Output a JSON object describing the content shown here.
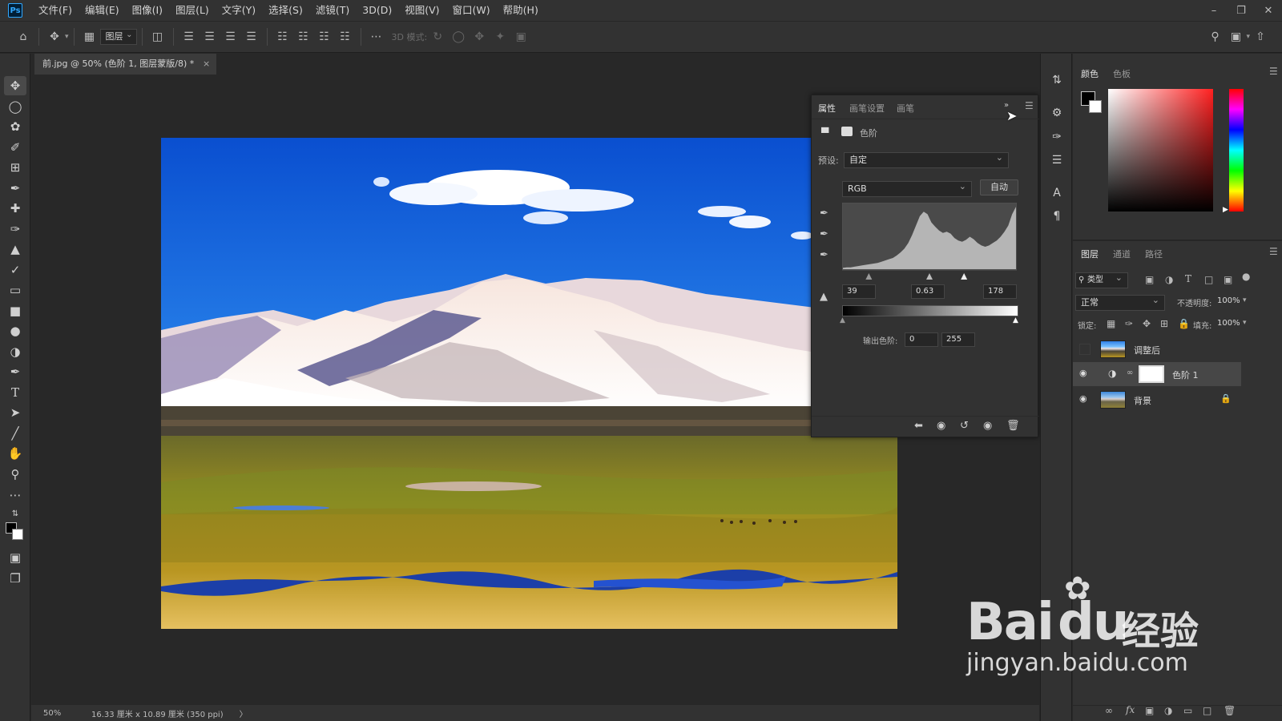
{
  "app": {
    "logo": "Ps"
  },
  "menu": [
    "文件(F)",
    "编辑(E)",
    "图像(I)",
    "图层(L)",
    "文字(Y)",
    "选择(S)",
    "滤镜(T)",
    "3D(D)",
    "视图(V)",
    "窗口(W)",
    "帮助(H)"
  ],
  "options_bar": {
    "layer_select": "图层",
    "mode_3d_label": "3D 模式:"
  },
  "document": {
    "tab_title": "前.jpg @ 50% (色阶 1, 图层蒙版/8) *",
    "close": "×"
  },
  "status": {
    "zoom": "50%",
    "doc_size": "16.33 厘米 x 10.89 厘米 (350 ppi)",
    "arrow": "〉"
  },
  "properties": {
    "tabs": [
      "属性",
      "画笔设置",
      "画笔"
    ],
    "adjustment_name": "色阶",
    "preset_label": "预设:",
    "preset_value": "自定",
    "channel_value": "RGB",
    "auto_button": "自动",
    "input_black": "39",
    "input_gamma": "0.63",
    "input_white": "178",
    "output_label": "输出色阶:",
    "output_black": "0",
    "output_white": "255",
    "histogram_samples": [
      2,
      3,
      3,
      4,
      5,
      6,
      7,
      8,
      9,
      10,
      12,
      14,
      16,
      18,
      22,
      27,
      33,
      42,
      55,
      70,
      85,
      92,
      88,
      75,
      68,
      62,
      58,
      60,
      57,
      50,
      46,
      44,
      47,
      52,
      48,
      42,
      38,
      36,
      38,
      42,
      46,
      52,
      60,
      70,
      88,
      100
    ],
    "input_black_fraction": 0.153,
    "input_gamma_fraction": 0.5,
    "input_white_fraction": 0.698
  },
  "color_panel": {
    "tabs": [
      "颜色",
      "色板"
    ],
    "foreground": "#000000",
    "background": "#ffffff",
    "hue_color": "#ff2020"
  },
  "layers_panel": {
    "tabs": [
      "图层",
      "通道",
      "路径"
    ],
    "filter_kind": "类型",
    "blend_mode": "正常",
    "opacity_label": "不透明度:",
    "opacity_value": "100%",
    "lock_label": "锁定:",
    "fill_label": "填充:",
    "fill_value": "100%",
    "layers": [
      {
        "name": "调整后",
        "visible": false,
        "selected": false
      },
      {
        "name": "色阶 1",
        "visible": true,
        "selected": true
      },
      {
        "name": "背景",
        "visible": true,
        "selected": false
      }
    ]
  },
  "watermark": {
    "brand_latin_1": "Bai",
    "brand_latin_2": "du",
    "brand_cn": "经验",
    "url": "jingyan.baidu.com"
  }
}
